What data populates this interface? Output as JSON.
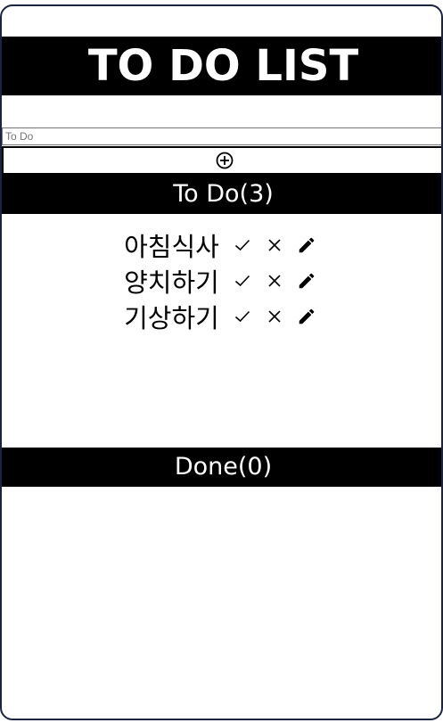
{
  "app": {
    "title": "TO DO LIST"
  },
  "input": {
    "placeholder": "To Do",
    "value": ""
  },
  "add_button": {
    "icon": "plus-circle-icon"
  },
  "todo_section": {
    "header": "To Do(3)",
    "items": [
      {
        "text": "아침식사"
      },
      {
        "text": "양치하기"
      },
      {
        "text": "기상하기"
      }
    ],
    "item_actions": [
      "check-icon",
      "close-icon",
      "pencil-icon"
    ]
  },
  "done_section": {
    "header": "Done(0)",
    "items": []
  },
  "colors": {
    "header_bg": "#000000",
    "header_text": "#ffffff",
    "frame_border": "#1b2540"
  }
}
